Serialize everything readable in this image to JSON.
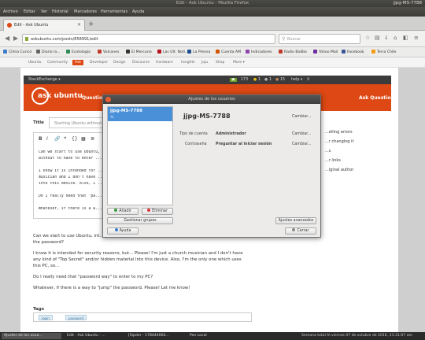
{
  "window": {
    "title": "Edit - Ask Ubuntu - Mozilla Firefox",
    "indicator": "jjpg-MS-7788"
  },
  "menu": [
    "Archivo",
    "Editar",
    "Ver",
    "Historial",
    "Marcadores",
    "Herramientas",
    "Ayuda"
  ],
  "tab": {
    "label": "Edit - Ask Ubuntu"
  },
  "nav": {
    "url": "askubuntu.com/posts/858991/edit",
    "search_placeholder": "Buscar"
  },
  "bookmarks": [
    {
      "label": "Clima Curicó",
      "color": "#3b7bc8"
    },
    {
      "label": "Diario la...",
      "color": "#666"
    },
    {
      "label": "Ecotología",
      "color": "#2e8b57"
    },
    {
      "label": "Volcanes",
      "color": "#c0392b"
    },
    {
      "label": "El Mercurio",
      "color": "#333"
    },
    {
      "label": "Las Últ. Noti...",
      "color": "#b5131b"
    },
    {
      "label": "La Prensa",
      "color": "#1f4e8c"
    },
    {
      "label": "Cuenta AM",
      "color": "#d35400"
    },
    {
      "label": "Indicadores",
      "color": "#8e44ad"
    },
    {
      "label": "Radio BioBio",
      "color": "#c0392b"
    },
    {
      "label": "Yahoo Mail",
      "color": "#6b2fa0"
    },
    {
      "label": "Facebook",
      "color": "#3b5998"
    },
    {
      "label": "Terra Chile",
      "color": "#f39c12"
    }
  ],
  "ubuntu_nav": [
    "Ubuntu",
    "Community",
    "Ask",
    "Developer",
    "Design",
    "Discourse",
    "Hardware",
    "Insights",
    "Juju",
    "Shop",
    "More ▾"
  ],
  "se": {
    "brand": "StackExchange ▾",
    "rep": "173",
    "badge1": "1",
    "badge2": "1",
    "badge3": "15",
    "help": "help ▾"
  },
  "header": {
    "logo_text": "ask ubuntu",
    "questions": "Questions",
    "ask": "Ask Question"
  },
  "form": {
    "title_label": "Title",
    "title_value": "Starting Ubuntu without to have to enter the password",
    "editor_lines": [
      "Can we start to use Ubuntu, int...",
      "without to have to enter ...",
      "",
      "I know it is intended for ...",
      "musician and I don't have ...",
      "into this device. Also, I ...",
      "",
      "Do I really need that \"pa...",
      "",
      "Whatever, if there is a w..."
    ],
    "preview": [
      "Can we start to use Ubuntu, int...",
      "the password?",
      "",
      "I know it is intended for security reasons, but... Please! I'm just a church musician and I don't have",
      "any kind of \"Top Secret\" and/or hidden material into this device. Also, I'm the only one which uses",
      "this PC, so...",
      "",
      "Do I really need that \"password way\" to enter to my PC?",
      "",
      "Whatever, if there is a way to \"jump\" the password, Please! Let me know!"
    ],
    "side": [
      "...elling errors",
      "...r changing it",
      "...s",
      "...r links",
      "...iginal author"
    ],
    "tags_label": "Tags",
    "tags": [
      "login",
      "password"
    ]
  },
  "dialog": {
    "title": "Ajustes de los usuarios",
    "user_name": "jjpg-MS-7788",
    "user_sub": "Yo",
    "big_name": "jjpg-MS-7788",
    "account_type_label": "Tipo de cuenta",
    "account_type_value": "Administrador",
    "password_label": "Contraseña",
    "password_value": "Preguntar al iniciar sesión",
    "change1": "Cambiar...",
    "change2": "Cambiar...",
    "change3": "Cambiar...",
    "add": "Añadir",
    "remove": "Eliminar",
    "groups": "Gestionar grupos",
    "advanced": "Ajustes avanzados",
    "help": "Ayuda",
    "close": "Cerrar"
  },
  "taskbar": [
    {
      "label": "Ajustes de los usua...",
      "active": true
    },
    {
      "label": "Edit - Ask Ubuntu - ...",
      "active": false
    },
    {
      "label": "[Sipder - 178444064...",
      "active": false
    },
    {
      "label": "Pen Local",
      "active": false
    },
    {
      "label": "Semana total Al viernes 07 de octubre de 2016, 21:31:07 am",
      "active": false
    }
  ]
}
